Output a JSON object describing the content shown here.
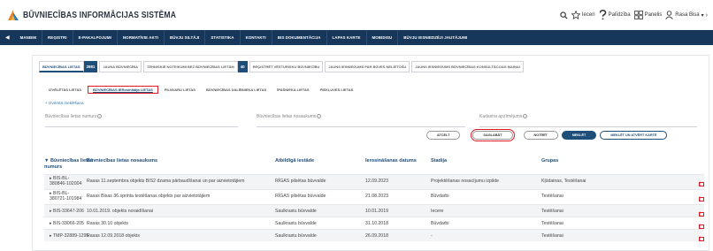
{
  "app": {
    "title": "BŪVNIECĪBAS INFORMĀCIJAS SISTĒMA"
  },
  "toolbar": {
    "search_label": "",
    "favorites_label": "Ieceri",
    "help_label": "Palīdzība",
    "panels_label": "Panelis",
    "user_label": "Rasa Bisa"
  },
  "nav": {
    "items": [
      "MANIEM",
      "REĢISTRI",
      "E-PAKALPOJUMI",
      "NORMATĪVIE AKTI",
      "BŪVJU SILTĀJI",
      "STATISTIKA",
      "KONTAKTI",
      "BIS DOKUMENTĀCIJA",
      "LAPAS KARTE",
      "MOBIDISU",
      "BŪVJU IESNIEDZĒJI JAUTĀJUMI"
    ]
  },
  "tabs": [
    {
      "label": "BŪVNIECĪBAS LIETAS",
      "count": "2981"
    },
    {
      "label": "JAUNA BŪVNIECĪBA"
    },
    {
      "label": "TEHNISKIE NOTEIKUMI BEZ BŪVNIECĪBAS LIETĀM",
      "count": "40"
    },
    {
      "label": "REĢISTRĒT VĒSTURISKU BŪVNIECĪBU"
    },
    {
      "label": "JAUNS IESNIEGUMS PAR BŪVES NELIETOŠU"
    },
    {
      "label": "JAUNS IESNIEGUMS BŪVNIECĪBAS KONSULTĀCIJAS MAIŅAI"
    }
  ],
  "subtabs": [
    "IZVĒLĒTĀS LIETAS",
    "BŪVNIECĪBAS IERosinātāja LIETAS",
    "PILNVARU LIETAS",
    "BŪVNIECĪBAS DALĪBNIEKA LIETAS",
    "ĪPAŠNIEKA LIETAS",
    "PIEKĻUVES LIETAS"
  ],
  "expand_label": "+ Izvērstā meklēšana",
  "filters": {
    "case_number": "Būvniecības lietas numurs",
    "case_name": "Būvniecības lietas nosaukums",
    "cadastral": "Kadastra apzīmējums"
  },
  "buttons": {
    "save": "SAGLABĀT",
    "clear": "NOTĪRĪT",
    "cancel": "ATCELT",
    "search": "MEKLĒT",
    "search_map": "MEKLĒT UN ATVĒRT KARTĒ"
  },
  "table": {
    "headers": [
      "▼ Būvniecības lietas numurs",
      "Būvniecības lietas nosaukums",
      "Atbildīgā iestāde",
      "Ierosināšanas datums",
      "Stadija",
      "Grupas"
    ],
    "rows": [
      {
        "num": "▸ BIS-BL-380846-102004",
        "name": "Rasas 11.septembra objekts BIS2 dzama pārbaudīšanai un par aizvietotājiem",
        "org": "RĪGAS pilsētas būvvalde",
        "date": "12.09.2023",
        "stage": "Projektēšanas nosacījumu izpilde",
        "group": "Kļūdainas, Testēšanai"
      },
      {
        "num": "▸ BIS-BL-380721-101984",
        "name": "Rasas Bisas 36.sprinta testēšanas objekts par aizvietotājiem",
        "org": "RĪGAS pilsētas būvvalde",
        "date": "21.08.2023",
        "stage": "Būvdarbi",
        "group": "Testēšanai"
      },
      {
        "num": "▸ BIS-33647-206",
        "name": "10.01.2019. objekts noraidīšanai",
        "org": "Saulkrastu būvvalde",
        "date": "10.01.2019",
        "stage": "Iecere",
        "group": "Testēšanai"
      },
      {
        "num": "▸ BIS-33066-205",
        "name": "Rasas 30.10 objekts",
        "org": "Saulkrastu būvvalde",
        "date": "31.10.2018",
        "stage": "Būvdarbi",
        "group": "Testēšanai"
      },
      {
        "num": "▸ TMP-32889-1295",
        "name": "Rasas 12.09.2018 objekts",
        "org": "Saulkrastu būvvalde",
        "date": "26.09.2018",
        "stage": "-",
        "group": "Testēšanai"
      }
    ]
  },
  "colors": {
    "nav": "#16365a",
    "accent": "#1f4e79",
    "highlight": "#e01a24"
  }
}
